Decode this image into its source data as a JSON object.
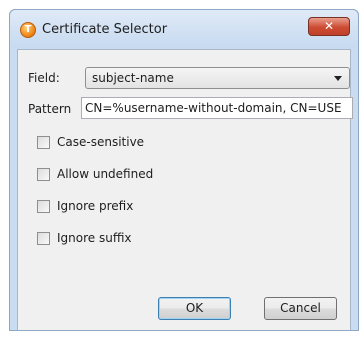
{
  "window": {
    "title": "Certificate Selector",
    "app_icon_glyph": "T",
    "close_glyph": "✕"
  },
  "form": {
    "field_label": "Field:",
    "field_value": "subject-name",
    "pattern_label": "Pattern",
    "pattern_value": "CN=%username-without-domain, CN=USE"
  },
  "options": [
    {
      "label": "Case-sensitive",
      "checked": false
    },
    {
      "label": "Allow undefined",
      "checked": false
    },
    {
      "label": "Ignore prefix",
      "checked": false
    },
    {
      "label": "Ignore suffix",
      "checked": false
    }
  ],
  "buttons": {
    "ok": "OK",
    "cancel": "Cancel"
  }
}
